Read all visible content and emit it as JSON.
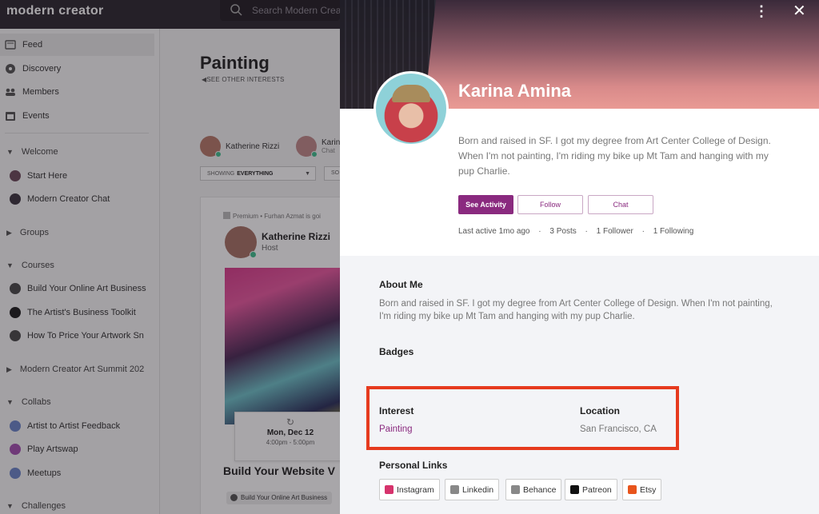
{
  "app": {
    "logo": "modern creator",
    "search_placeholder": "Search Modern Creator"
  },
  "sidebar": {
    "nav": [
      {
        "label": "Feed",
        "icon": "feed-icon"
      },
      {
        "label": "Discovery",
        "icon": "compass-icon"
      },
      {
        "label": "Members",
        "icon": "members-icon"
      },
      {
        "label": "Events",
        "icon": "calendar-icon"
      }
    ],
    "sections": [
      {
        "label": "Welcome",
        "items": [
          "Start Here",
          "Modern Creator Chat"
        ]
      },
      {
        "label": "Groups",
        "items": []
      },
      {
        "label": "Courses",
        "items": [
          "Build Your Online Art Business",
          "The Artist's Business Toolkit",
          "How To Price Your Artwork Sn"
        ]
      },
      {
        "label": "Modern Creator Art Summit 202",
        "items": []
      },
      {
        "label": "Collabs",
        "items": [
          "Artist to Artist Feedback",
          "Play Artswap",
          "Meetups"
        ]
      },
      {
        "label": "Challenges",
        "items": []
      }
    ]
  },
  "feed": {
    "title": "Painting",
    "back_link": "SEE OTHER INTERESTS",
    "hosts": [
      {
        "name": "Katherine Rizzi"
      },
      {
        "name": "Karin",
        "sub": "Chat"
      }
    ],
    "filter_label": "SHOWING",
    "filter_value": "EVERYTHING",
    "filter2": "SO",
    "post": {
      "meta": "Premium • Furhan Azmat is goi",
      "author": "Katherine Rizzi",
      "role": "Host",
      "date": "Mon, Dec 12",
      "time": "4:00pm - 5:00pm",
      "title": "Build Your Website V",
      "course_chip": "Build Your Online Art Business"
    }
  },
  "profile": {
    "name": "Karina Amina",
    "bio": "Born and raised in SF. I got my degree from Art Center College of Design. When I'm not painting, I'm riding my bike up Mt Tam and hanging with my pup Charlie.",
    "buttons": {
      "activity": "See Activity",
      "follow": "Follow",
      "chat": "Chat"
    },
    "stats": {
      "last_active": "Last active 1mo ago",
      "posts": "3 Posts",
      "followers": "1 Follower",
      "following": "1 Following"
    },
    "about_heading": "About Me",
    "about_text": "Born and raised in SF. I got my degree from Art Center College of Design. When I'm not painting, I'm riding my bike up Mt Tam and hanging with my pup Charlie.",
    "badges_heading": "Badges",
    "interest_heading": "Interest",
    "interest_value": "Painting",
    "location_heading": "Location",
    "location_value": "San Francisco, CA",
    "links_heading": "Personal Links",
    "links": [
      {
        "label": "Instagram",
        "icon": "instagram-icon",
        "color": "#d6336c"
      },
      {
        "label": "Linkedin",
        "icon": "linkedin-icon",
        "color": "#888888"
      },
      {
        "label": "Behance",
        "icon": "behance-icon",
        "color": "#888888"
      },
      {
        "label": "Patreon",
        "icon": "patreon-icon",
        "color": "#111111"
      },
      {
        "label": "Etsy",
        "icon": "etsy-icon",
        "color": "#e8541c"
      }
    ]
  },
  "colors": {
    "accent": "#8a2a7f",
    "highlight": "#e63a1e",
    "topbar": "#2c2730"
  }
}
